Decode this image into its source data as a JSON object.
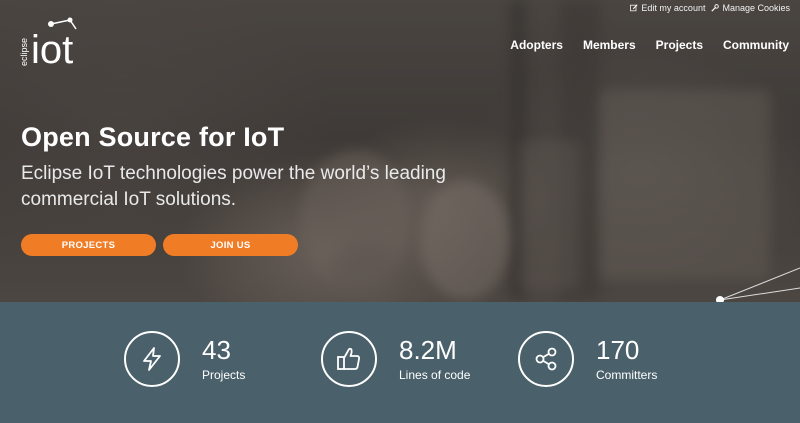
{
  "util_links": {
    "edit_account": "Edit my account",
    "manage_cookies": "Manage Cookies"
  },
  "logo": {
    "small_text": "eclipse",
    "big_text": "iot"
  },
  "nav": {
    "items": [
      "Adopters",
      "Members",
      "Projects",
      "Community"
    ]
  },
  "hero": {
    "title": "Open Source for IoT",
    "subtitle": "Eclipse IoT technologies power the world’s leading commercial IoT solutions.",
    "buttons": {
      "projects": "PROJECTS",
      "join": "JOIN US"
    }
  },
  "stats": [
    {
      "icon": "lightning-icon",
      "value": "43",
      "label": "Projects"
    },
    {
      "icon": "thumbs-up-icon",
      "value": "8.2M",
      "label": "Lines of code"
    },
    {
      "icon": "share-icon",
      "value": "170",
      "label": "Committers"
    }
  ],
  "colors": {
    "accent": "#f07c26",
    "stats_bg": "#4a606a"
  }
}
